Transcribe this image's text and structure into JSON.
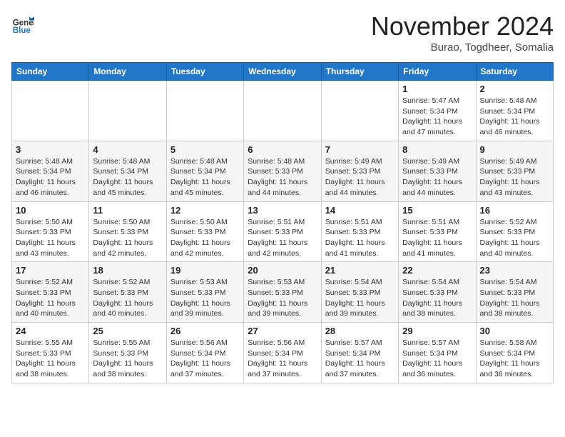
{
  "header": {
    "logo_general": "General",
    "logo_blue": "Blue",
    "title": "November 2024",
    "location": "Burao, Togdheer, Somalia"
  },
  "weekdays": [
    "Sunday",
    "Monday",
    "Tuesday",
    "Wednesday",
    "Thursday",
    "Friday",
    "Saturday"
  ],
  "weeks": [
    [
      {
        "day": "",
        "info": ""
      },
      {
        "day": "",
        "info": ""
      },
      {
        "day": "",
        "info": ""
      },
      {
        "day": "",
        "info": ""
      },
      {
        "day": "",
        "info": ""
      },
      {
        "day": "1",
        "info": "Sunrise: 5:47 AM\nSunset: 5:34 PM\nDaylight: 11 hours and 47 minutes."
      },
      {
        "day": "2",
        "info": "Sunrise: 5:48 AM\nSunset: 5:34 PM\nDaylight: 11 hours and 46 minutes."
      }
    ],
    [
      {
        "day": "3",
        "info": "Sunrise: 5:48 AM\nSunset: 5:34 PM\nDaylight: 11 hours and 46 minutes."
      },
      {
        "day": "4",
        "info": "Sunrise: 5:48 AM\nSunset: 5:34 PM\nDaylight: 11 hours and 45 minutes."
      },
      {
        "day": "5",
        "info": "Sunrise: 5:48 AM\nSunset: 5:34 PM\nDaylight: 11 hours and 45 minutes."
      },
      {
        "day": "6",
        "info": "Sunrise: 5:48 AM\nSunset: 5:33 PM\nDaylight: 11 hours and 44 minutes."
      },
      {
        "day": "7",
        "info": "Sunrise: 5:49 AM\nSunset: 5:33 PM\nDaylight: 11 hours and 44 minutes."
      },
      {
        "day": "8",
        "info": "Sunrise: 5:49 AM\nSunset: 5:33 PM\nDaylight: 11 hours and 44 minutes."
      },
      {
        "day": "9",
        "info": "Sunrise: 5:49 AM\nSunset: 5:33 PM\nDaylight: 11 hours and 43 minutes."
      }
    ],
    [
      {
        "day": "10",
        "info": "Sunrise: 5:50 AM\nSunset: 5:33 PM\nDaylight: 11 hours and 43 minutes."
      },
      {
        "day": "11",
        "info": "Sunrise: 5:50 AM\nSunset: 5:33 PM\nDaylight: 11 hours and 42 minutes."
      },
      {
        "day": "12",
        "info": "Sunrise: 5:50 AM\nSunset: 5:33 PM\nDaylight: 11 hours and 42 minutes."
      },
      {
        "day": "13",
        "info": "Sunrise: 5:51 AM\nSunset: 5:33 PM\nDaylight: 11 hours and 42 minutes."
      },
      {
        "day": "14",
        "info": "Sunrise: 5:51 AM\nSunset: 5:33 PM\nDaylight: 11 hours and 41 minutes."
      },
      {
        "day": "15",
        "info": "Sunrise: 5:51 AM\nSunset: 5:33 PM\nDaylight: 11 hours and 41 minutes."
      },
      {
        "day": "16",
        "info": "Sunrise: 5:52 AM\nSunset: 5:33 PM\nDaylight: 11 hours and 40 minutes."
      }
    ],
    [
      {
        "day": "17",
        "info": "Sunrise: 5:52 AM\nSunset: 5:33 PM\nDaylight: 11 hours and 40 minutes."
      },
      {
        "day": "18",
        "info": "Sunrise: 5:52 AM\nSunset: 5:33 PM\nDaylight: 11 hours and 40 minutes."
      },
      {
        "day": "19",
        "info": "Sunrise: 5:53 AM\nSunset: 5:33 PM\nDaylight: 11 hours and 39 minutes."
      },
      {
        "day": "20",
        "info": "Sunrise: 5:53 AM\nSunset: 5:33 PM\nDaylight: 11 hours and 39 minutes."
      },
      {
        "day": "21",
        "info": "Sunrise: 5:54 AM\nSunset: 5:33 PM\nDaylight: 11 hours and 39 minutes."
      },
      {
        "day": "22",
        "info": "Sunrise: 5:54 AM\nSunset: 5:33 PM\nDaylight: 11 hours and 38 minutes."
      },
      {
        "day": "23",
        "info": "Sunrise: 5:54 AM\nSunset: 5:33 PM\nDaylight: 11 hours and 38 minutes."
      }
    ],
    [
      {
        "day": "24",
        "info": "Sunrise: 5:55 AM\nSunset: 5:33 PM\nDaylight: 11 hours and 38 minutes."
      },
      {
        "day": "25",
        "info": "Sunrise: 5:55 AM\nSunset: 5:33 PM\nDaylight: 11 hours and 38 minutes."
      },
      {
        "day": "26",
        "info": "Sunrise: 5:56 AM\nSunset: 5:34 PM\nDaylight: 11 hours and 37 minutes."
      },
      {
        "day": "27",
        "info": "Sunrise: 5:56 AM\nSunset: 5:34 PM\nDaylight: 11 hours and 37 minutes."
      },
      {
        "day": "28",
        "info": "Sunrise: 5:57 AM\nSunset: 5:34 PM\nDaylight: 11 hours and 37 minutes."
      },
      {
        "day": "29",
        "info": "Sunrise: 5:57 AM\nSunset: 5:34 PM\nDaylight: 11 hours and 36 minutes."
      },
      {
        "day": "30",
        "info": "Sunrise: 5:58 AM\nSunset: 5:34 PM\nDaylight: 11 hours and 36 minutes."
      }
    ]
  ]
}
